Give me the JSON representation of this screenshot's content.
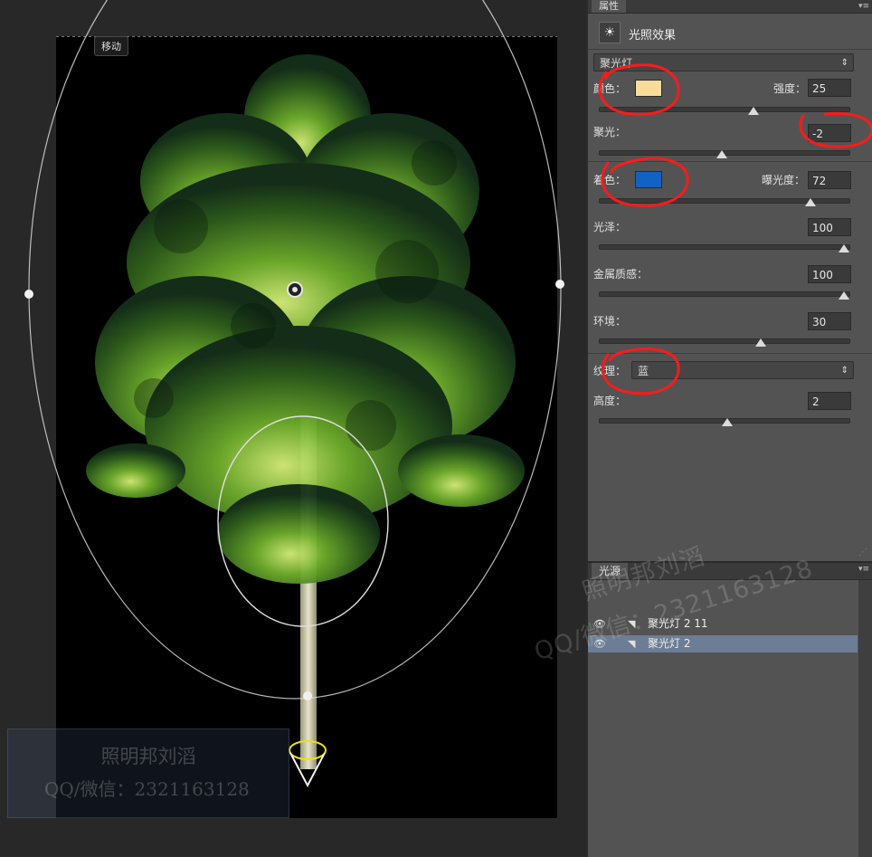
{
  "canvas": {
    "tool_tip": "移动"
  },
  "watermark": {
    "line1": "照明邦刘滔",
    "line2": "QQ/微信：2321163128",
    "diag_line1": "照明邦刘滔",
    "diag_line2": "QQ/微信：2321163128"
  },
  "properties": {
    "tab_label": "属性",
    "menu_icon": "panel-menu-icon",
    "effect_icon": "light-effect-icon",
    "effect_title": "光照效果",
    "light_type": "聚光灯",
    "color_label": "颜色：",
    "color_value": "#f7dc9a",
    "intensity_label": "强度：",
    "intensity": "25",
    "intensity_level": 0.62,
    "hotspot_label": "聚光：",
    "hotspot": "-2",
    "hotspot_level": 0.49,
    "ambient_color_label": "着色：",
    "ambient_color_value": "#1262c4",
    "exposure_label": "曝光度：",
    "exposure": "72",
    "exposure_level": 0.86,
    "gloss_label": "光泽：",
    "gloss": "100",
    "gloss_level": 1.0,
    "metallic_label": "金属质感：",
    "metallic": "100",
    "metallic_level": 1.0,
    "ambience_label": "环境：",
    "ambience": "30",
    "ambience_level": 0.65,
    "texture_label": "纹理：",
    "texture": "蓝",
    "height_label": "高度：",
    "height": "2",
    "height_level": 0.51
  },
  "lights": {
    "tab_label": "光源",
    "items": [
      {
        "name": "聚光灯 2 11",
        "selected": false
      },
      {
        "name": "聚光灯 2",
        "selected": true
      }
    ]
  },
  "colors": {
    "panel_bg": "#535353",
    "selection": "#6c7d95",
    "annotation_red": "#ff1a1a"
  }
}
